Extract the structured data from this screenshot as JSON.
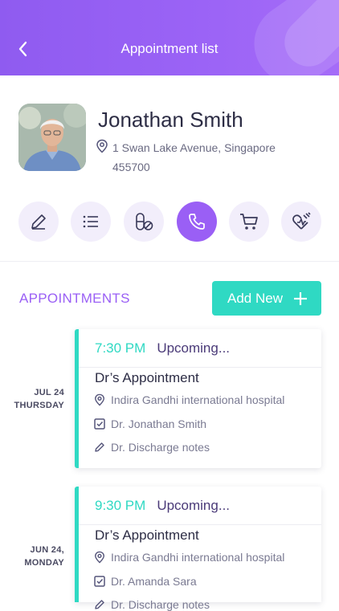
{
  "header": {
    "title": "Appointment list"
  },
  "profile": {
    "name": "Jonathan Smith",
    "address_line1": "1 Swan Lake Avenue, Singapore",
    "address_line2": "455700"
  },
  "actions": [
    {
      "name": "edit-icon"
    },
    {
      "name": "list-icon"
    },
    {
      "name": "pills-icon"
    },
    {
      "name": "phone-icon",
      "active": true
    },
    {
      "name": "cart-icon"
    },
    {
      "name": "heart-pulse-icon"
    }
  ],
  "appointments_section": {
    "title": "APPOINTMENTS",
    "add_label": "Add New"
  },
  "appointments": [
    {
      "date_line1": "JUL 24",
      "date_line2": "THURSDAY",
      "time": "7:30 PM",
      "status": "Upcoming...",
      "title": "Dr’s Appointment",
      "location": "Indira Gandhi international hospital",
      "doctor": "Dr. Jonathan Smith",
      "note": "Dr. Discharge notes"
    },
    {
      "date_line1": "JUN 24,",
      "date_line2": "MONDAY",
      "time": "9:30 PM",
      "status": "Upcoming...",
      "title": "Dr’s Appointment",
      "location": "Indira Gandhi international hospital",
      "doctor": "Dr. Amanda Sara",
      "note": "Dr. Discharge notes"
    }
  ],
  "colors": {
    "primary": "#9a5ff5",
    "accent": "#2fd9c3",
    "text_dark": "#2d2d45"
  }
}
